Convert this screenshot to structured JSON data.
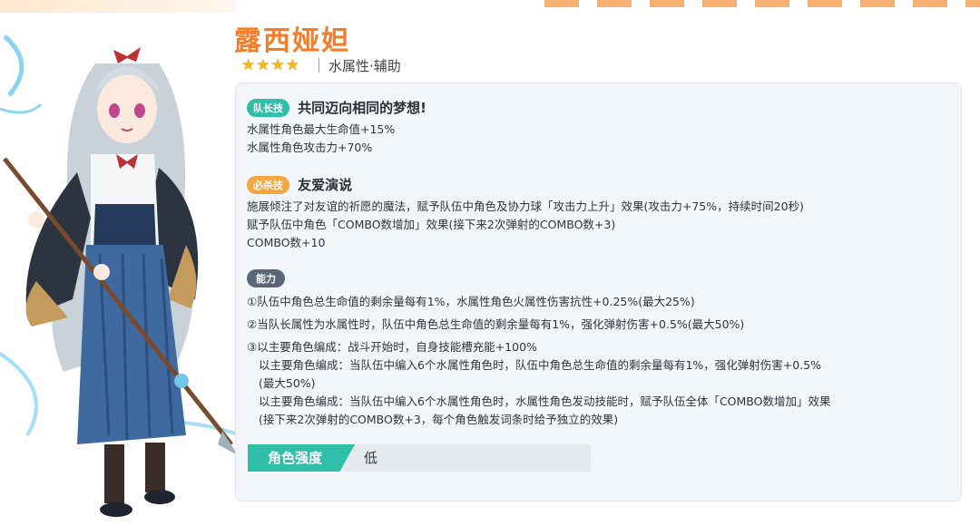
{
  "character": {
    "name": "露西娅妲",
    "rarity": 4,
    "star_glyph": "★",
    "attribute": "水属性·辅助",
    "illustration": "character-illustration"
  },
  "leader_skill": {
    "tag": "队长技",
    "name": "共同迈向相同的梦想!",
    "lines": [
      "水属性角色最大生命值+15%",
      "水属性角色攻击力+70%"
    ]
  },
  "special_skill": {
    "tag": "必杀技",
    "name": "友爱演说",
    "lines": [
      "施展倾注了对友谊的祈愿的魔法，赋予队伍中角色及协力球「攻击力上升」效果(攻击力+75%，持续时间20秒)",
      "赋予队伍中角色「COMBO数增加」效果(接下来2次弹射的COMBO数+3)",
      "COMBO数+10"
    ]
  },
  "abilities": {
    "tag": "能力",
    "lines": [
      "①队伍中角色总生命值的剩余量每有1%，水属性角色火属性伤害抗性+0.25%(最大25%)",
      "②当队长属性为水属性时，队伍中角色总生命值的剩余量每有1%，强化弹射伤害+0.5%(最大50%)",
      "③以主要角色编成：战斗开始时，自身技能槽充能+100%",
      "以主要角色编成：当队伍中编入6个水属性角色时，队伍中角色总生命值的剩余量每有1%，强化弹射伤害+0.5%",
      "(最大50%)",
      "以主要角色编成：当队伍中编入6个水属性角色时，水属性角色发动技能时，赋予队伍全体「COMBO数增加」效果",
      "(接下来2次弹射的COMBO数+3，每个角色触发词条时给予独立的效果)"
    ]
  },
  "rating": {
    "label": "角色强度",
    "value": "低"
  },
  "colors": {
    "name": "#f47d2a",
    "leader_tag": "#2fbfa8",
    "special_tag": "#f4a640",
    "ability_tag": "#5a6777",
    "star": "#f5b81c"
  }
}
